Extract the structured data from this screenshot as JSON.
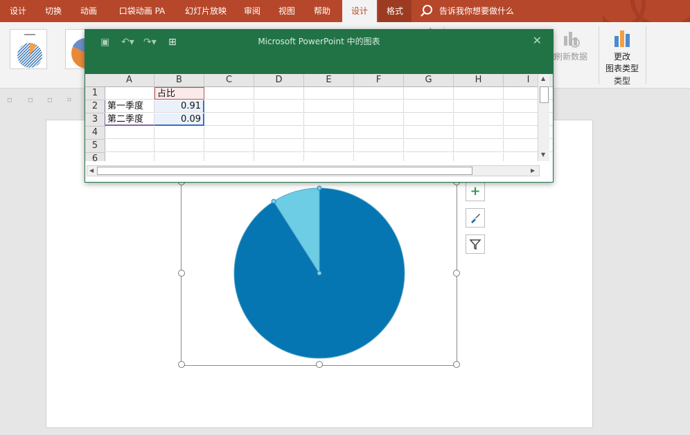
{
  "ribbon_tabs": [
    "设计",
    "切换",
    "动画",
    "口袋动画 PA",
    "幻灯片放映",
    "审阅",
    "视图",
    "帮助",
    "设计",
    "格式"
  ],
  "active_tab_index": 8,
  "tell_me": "告诉我你想要做什么",
  "ribbon": {
    "refresh_data": "刷新数据",
    "change_chart_type_line1": "更改",
    "change_chart_type_line2": "图表类型",
    "type_group_title": "类型",
    "cut_glyph": "改"
  },
  "excel": {
    "title": "Microsoft PowerPoint 中的图表",
    "columns": [
      "A",
      "B",
      "C",
      "D",
      "E",
      "F",
      "G",
      "H",
      "I"
    ],
    "row_numbers": [
      "1",
      "2",
      "3",
      "4",
      "5",
      "6"
    ],
    "cells": [
      [
        "",
        "占比"
      ],
      [
        "第一季度",
        "0.91"
      ],
      [
        "第二季度",
        "0.09"
      ]
    ]
  },
  "chart_data": {
    "type": "pie",
    "categories": [
      "第一季度",
      "第二季度"
    ],
    "values": [
      0.91,
      0.09
    ],
    "colors": [
      "#0676b2",
      "#6ccde5"
    ],
    "title": "",
    "start_angle_deg": 0
  },
  "chart_tools": [
    "plus-icon",
    "brush-icon",
    "filter-icon"
  ],
  "colors": {
    "accent": "#b7472a",
    "excel_green": "#217346"
  }
}
